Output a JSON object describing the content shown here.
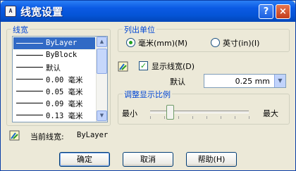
{
  "window": {
    "title": "线宽设置",
    "app_icon_text": "A"
  },
  "titlebar_buttons": {
    "help": "?",
    "close": "×"
  },
  "lineweights_group": {
    "label": "线宽",
    "items": [
      "ByLayer",
      "ByBlock",
      "默认",
      "0.00 毫米",
      "0.05 毫米",
      "0.09 毫米",
      "0.13 毫米"
    ],
    "selected_index": 0
  },
  "units_group": {
    "label": "列出单位",
    "mm_label": "毫米(mm)(M)",
    "in_label": "英寸(in)(I)",
    "selected": "mm"
  },
  "display": {
    "checkbox_label": "显示线宽(D)",
    "checked": true,
    "default_label": "默认",
    "default_value": "0.25 mm"
  },
  "scale_group": {
    "label": "调整显示比例",
    "min_label": "最小",
    "max_label": "最大",
    "level": 0.2
  },
  "current": {
    "label": "当前线宽:",
    "value": "ByLayer"
  },
  "buttons": {
    "ok": "确定",
    "cancel": "取消",
    "help": "帮助(H)"
  },
  "colors": {
    "title_blue": "#0454d6",
    "group_label": "#0046d5",
    "selection": "#316ac5"
  },
  "icons": {
    "lineweight_icon": "lineweight-icon"
  }
}
